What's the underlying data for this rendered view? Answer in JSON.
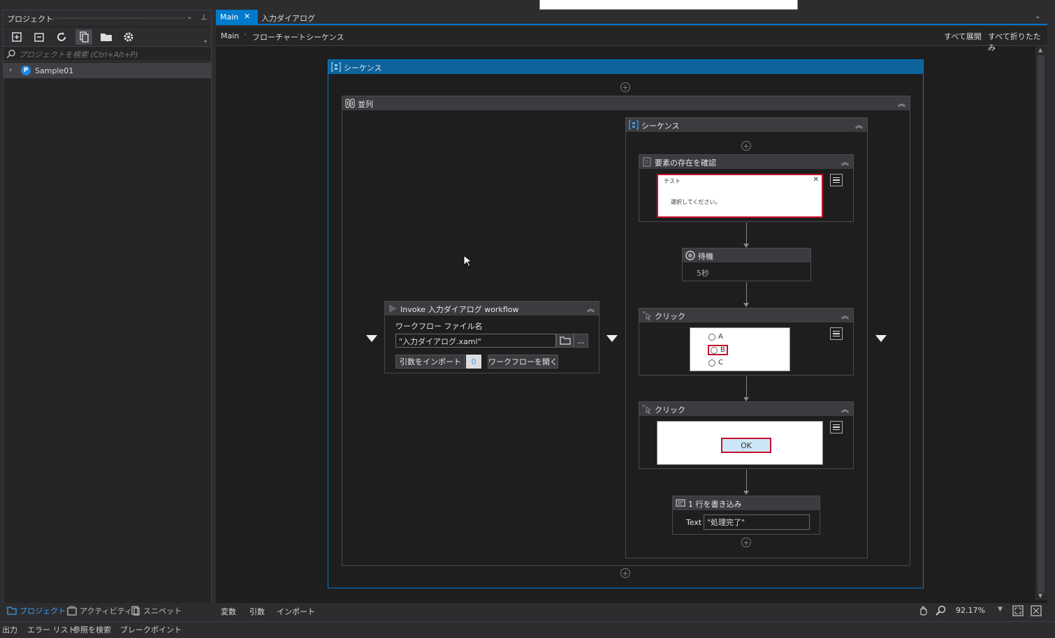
{
  "project_panel": {
    "title": "プロジェクト",
    "search_placeholder": "プロジェクトを検索 (Ctrl+Alt+P)",
    "tree": [
      {
        "label": "Sample01",
        "badge": "P"
      }
    ],
    "toolbar_icons": [
      "add-icon",
      "collapse-icon",
      "refresh-icon",
      "show-all-files-icon",
      "open-folder-icon",
      "settings-icon"
    ]
  },
  "left_tabs": [
    "プロジェクト",
    "アクティビティ",
    "スニペット"
  ],
  "bottom_tabs": [
    "出力",
    "エラー リスト",
    "参照を検索",
    "ブレークポイント"
  ],
  "doc_tabs": [
    {
      "label": "Main",
      "active": true
    },
    {
      "label": "入力ダイアログ",
      "active": false
    }
  ],
  "breadcrumb": [
    "Main",
    "フローチャート",
    "シーケンス"
  ],
  "designer_actions": {
    "expand_all": "すべて展開",
    "collapse_all": "すべて折りたたみ"
  },
  "workflow": {
    "outer_sequence": "シーケンス",
    "parallel": "並列",
    "invoke": {
      "title": "Invoke 入力ダイアログ workflow",
      "file_label": "ワークフロー ファイル名",
      "file_value": "\"入力ダイアログ.xaml\"",
      "browse_more": "...",
      "import_args": "引数をインポート",
      "arg_count": "0",
      "open_workflow": "ワークフローを開く"
    },
    "inner_sequence": "シーケンス",
    "element_exists": {
      "title": "要素の存在を確認",
      "preview_title": "テスト",
      "preview_close": "✕",
      "preview_text": "選択してください。"
    },
    "delay": {
      "title": "待機",
      "value": "5秒"
    },
    "click1": {
      "title": "クリック",
      "options": [
        "A",
        "B",
        "C"
      ]
    },
    "click2": {
      "title": "クリック",
      "ok_label": "OK"
    },
    "write_line": {
      "title": "1 行を書き込み",
      "text_label": "Text",
      "text_value": "\"処理完了\""
    }
  },
  "status_bar": {
    "variables": "変数",
    "arguments": "引数",
    "imports": "インポート",
    "zoom": "92.17%"
  }
}
